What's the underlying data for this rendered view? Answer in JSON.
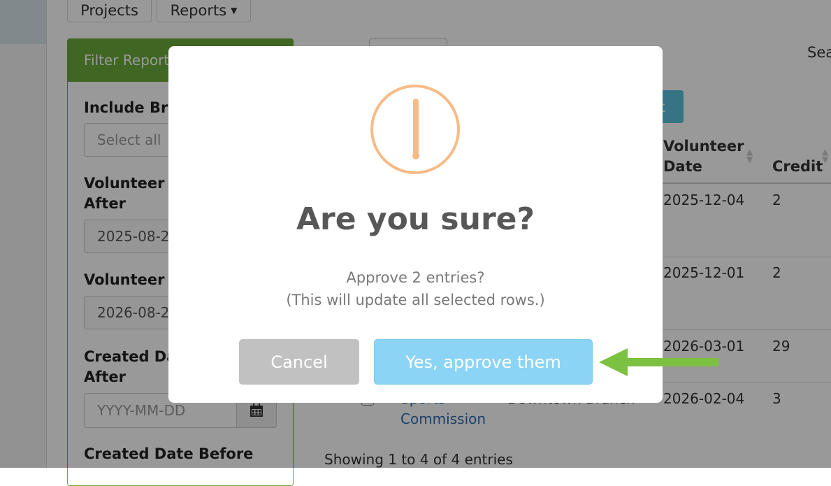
{
  "nav": {
    "projects_label": "Projects",
    "reports_label": "Reports"
  },
  "filter": {
    "header": "Filter Reports",
    "include_label": "Include Br",
    "include_placeholder": "Select all",
    "vol_after_label_1": "Volunteer",
    "vol_after_label_2": "After",
    "vol_after_value": "2025-08-2",
    "vol_before_label": "Volunteer",
    "vol_before_value": "2026-08-2",
    "created_after_label_1": "Created Da",
    "created_after_label_2": "After",
    "created_after_placeholder": "YYYY-MM-DD",
    "created_before_label": "Created Date Before"
  },
  "table": {
    "search_label": "Sea",
    "action_button_label": "xt",
    "headers": {
      "volunteer_date_1": "Volunteer",
      "volunteer_date_2": "Date",
      "credit": "Credit"
    },
    "rows": [
      {
        "date": "2025-12-04",
        "credit": "2"
      },
      {
        "date": "2025-12-01",
        "credit": "2"
      },
      {
        "date": "2026-03-01",
        "credit": "29"
      },
      {
        "date": "2026-02-04",
        "credit": "3",
        "org_1": "Sports",
        "org_2": "Commission",
        "branch": "Downtown Branch"
      }
    ],
    "footer": "Showing 1 to 4 of 4 entries"
  },
  "modal": {
    "title": "Are you sure?",
    "text_line1": "Approve 2 entries?",
    "text_line2": "(This will update all selected rows.)",
    "cancel_label": "Cancel",
    "confirm_label": "Yes, approve them"
  },
  "colors": {
    "panel_green": "#6aaa3a",
    "warning_orange": "#f8bb86",
    "confirm_blue": "#8cd4f5",
    "cancel_gray": "#c1c1c1",
    "arrow_green": "#7dc142"
  }
}
